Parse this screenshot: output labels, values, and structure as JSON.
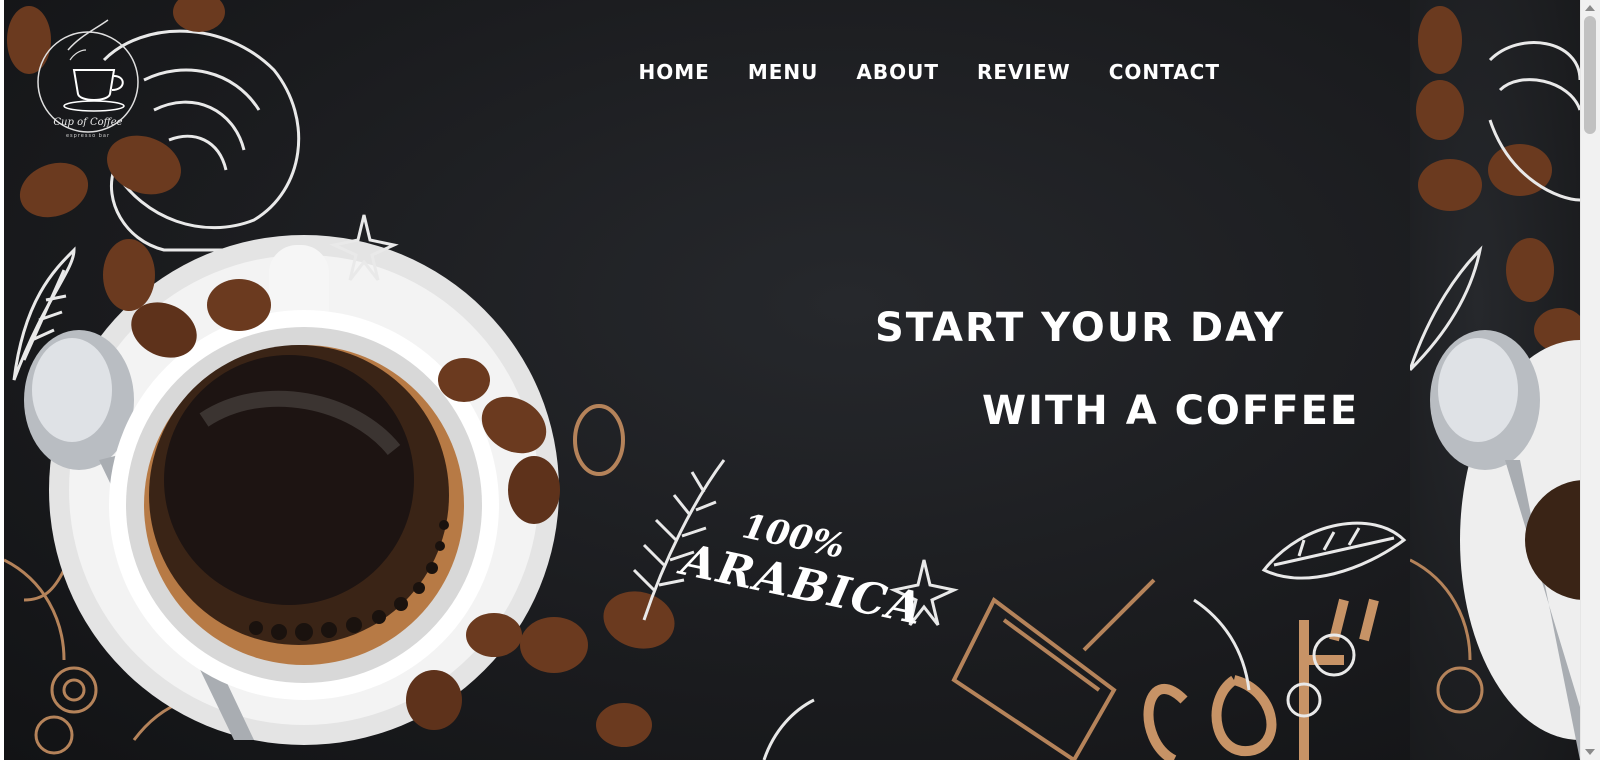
{
  "brand": {
    "name": "Cup of Coffee",
    "tagline": "espresso bar"
  },
  "nav": {
    "items": [
      "HOME",
      "MENU",
      "ABOUT",
      "REVIEW",
      "CONTACT"
    ]
  },
  "hero": {
    "line1": "START YOUR DAY",
    "line2": "WITH A COFFEE"
  },
  "decor": {
    "badge_percent": "100%",
    "badge_word": "ARABICA"
  },
  "colors": {
    "background": "#1b1c1f",
    "text": "#ffffff",
    "sketch_brown": "#b5835a",
    "bean": "#6b3a1f"
  },
  "icons": {
    "logo": "coffee-cup-logo-icon",
    "cup": "coffee-cup-illustration-icon",
    "bean": "coffee-bean-icon",
    "anise": "star-anise-icon",
    "spoon": "spoon-icon"
  }
}
